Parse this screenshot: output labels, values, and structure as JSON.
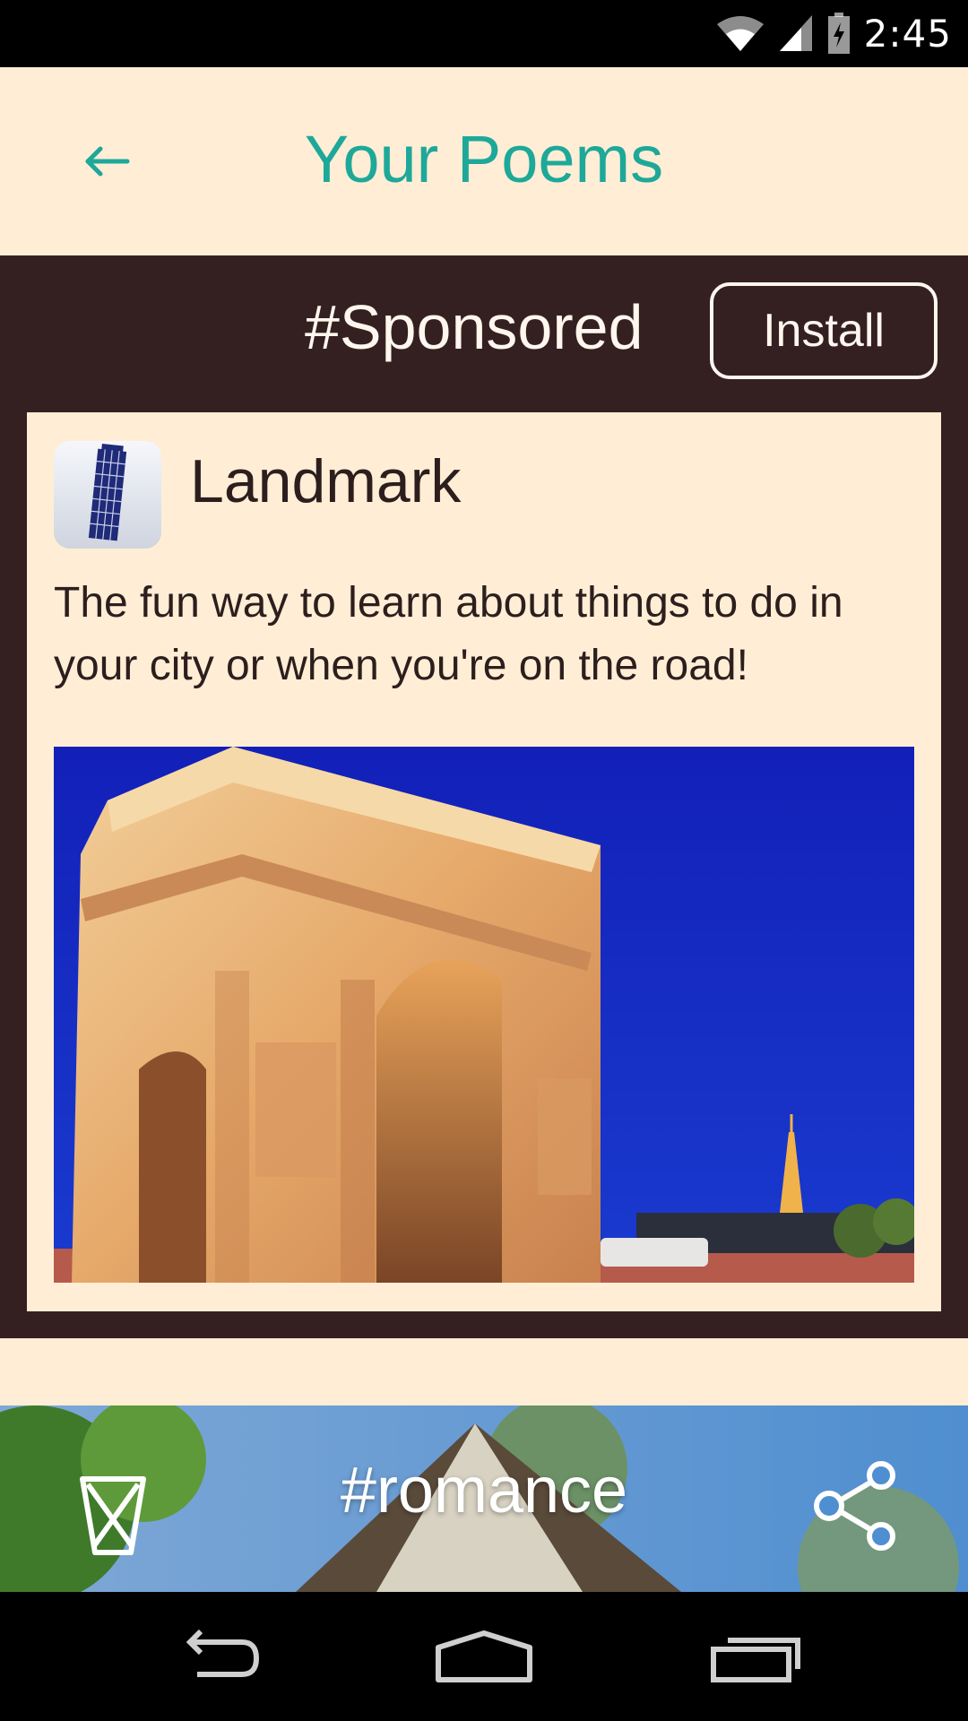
{
  "status_bar": {
    "time": "2:45",
    "icons": [
      "wifi-icon",
      "signal-icon",
      "battery-charging-icon"
    ]
  },
  "app_bar": {
    "back_icon": "back-arrow-icon",
    "title": "Your Poems"
  },
  "sponsored": {
    "tag": "#Sponsored",
    "install_label": "Install",
    "app_name": "Landmark",
    "app_icon": "leaning-tower-icon",
    "description": "The fun way to learn about things to do in your city or when you're on the road!",
    "image": "arc-de-triomphe-photo"
  },
  "poem": {
    "tag": "#romance",
    "delete_icon": "hourglass-delete-icon",
    "share_icon": "share-icon"
  },
  "nav_bar": {
    "icons": [
      "back-icon",
      "home-icon",
      "recents-icon"
    ]
  },
  "colors": {
    "background": "#FFEED5",
    "accent": "#1EA899",
    "sponsored_bg": "#352021",
    "text_dark": "#2D1E1E"
  }
}
